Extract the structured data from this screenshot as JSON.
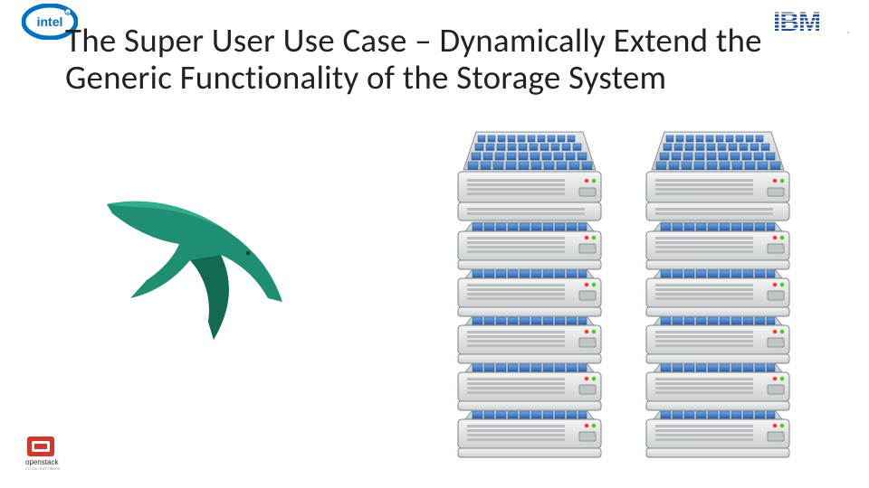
{
  "header": {
    "title": "The Super User Use Case – Dynamically Extend the Generic Functionality of the Storage System"
  },
  "logos": {
    "top_left": "intel",
    "top_right": "ibm",
    "bottom_left": "openstack"
  },
  "diagram": {
    "left_graphic": "swift-bird",
    "racks": 2,
    "nodes_per_rack": {
      "tall": 1,
      "short": 5
    }
  },
  "colors": {
    "intel_blue": "#0071C5",
    "ibm_blue": "#1F4E9C",
    "swift_teal": "#1E8F72",
    "server_body": "#E5E7E6",
    "server_edge": "#9FA4A7",
    "drive_blue": "#3E7FC7",
    "openstack_red": "#D7352B"
  }
}
